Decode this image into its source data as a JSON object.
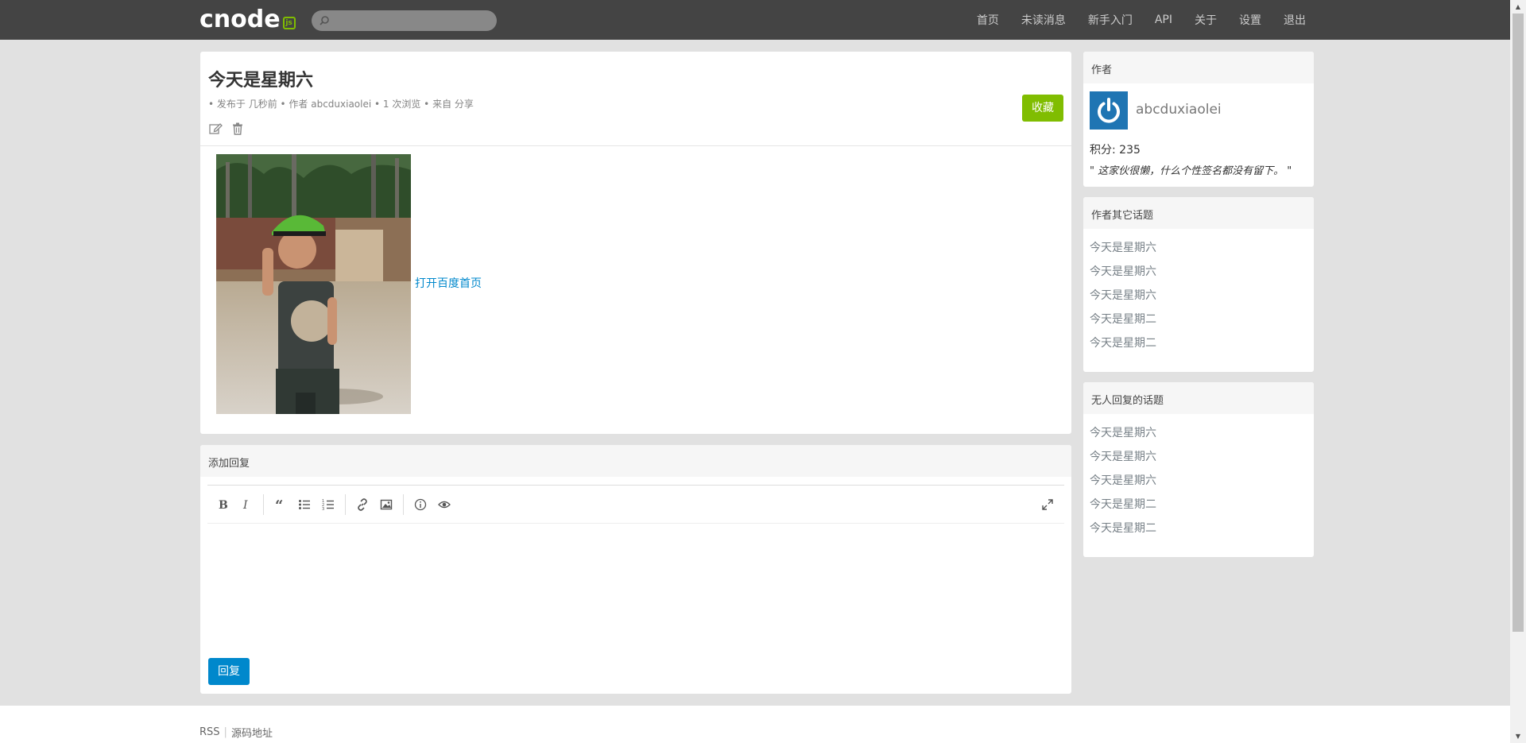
{
  "navbar": {
    "logo_text": "cnode",
    "logo_badge": "js",
    "search_placeholder": "",
    "links": [
      "首页",
      "未读消息",
      "新手入门",
      "API",
      "关于",
      "设置",
      "退出"
    ]
  },
  "topic": {
    "title": "今天是星期六",
    "meta": "• 发布于 几秒前 • 作者 abcduxiaolei • 1 次浏览 • 来自 分享",
    "favorite_label": "收藏",
    "link_text": "打开百度首页"
  },
  "reply": {
    "header": "添加回复",
    "submit_label": "回复"
  },
  "sidebar": {
    "author_header": "作者",
    "author_name": "abcduxiaolei",
    "score": "积分: 235",
    "signature": "\" 这家伙很懒，什么个性签名都没有留下。 \"",
    "other_header": "作者其它话题",
    "other_topics": [
      "今天是星期六",
      "今天是星期六",
      "今天是星期六",
      "今天是星期二",
      "今天是星期二"
    ],
    "noreply_header": "无人回复的话题",
    "noreply_topics": [
      "今天是星期六",
      "今天是星期六",
      "今天是星期六",
      "今天是星期二",
      "今天是星期二"
    ]
  },
  "footer": {
    "rss": "RSS",
    "source": "源码地址"
  },
  "colors": {
    "navbar": "#444444",
    "accent_green": "#80bd01",
    "accent_blue": "#0088cc",
    "background": "#e1e1e1"
  }
}
